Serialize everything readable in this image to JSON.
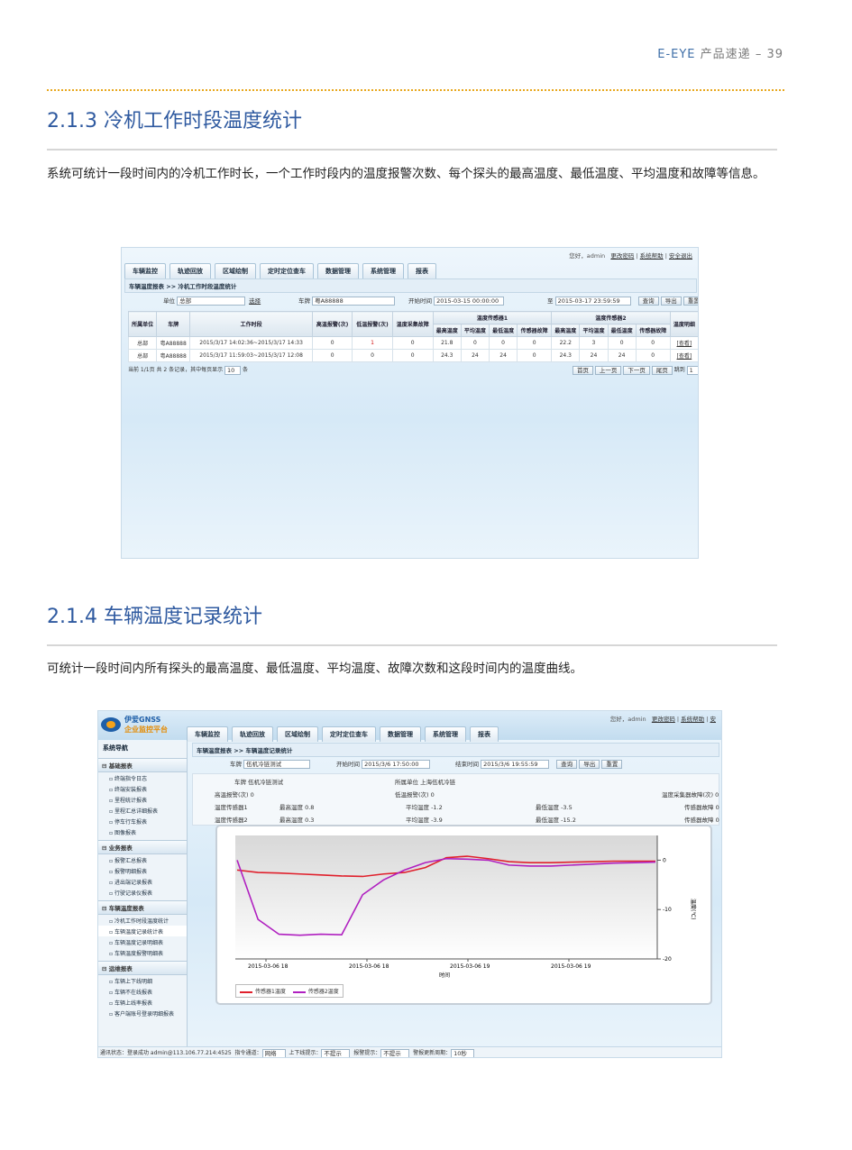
{
  "header": {
    "brand": "E-EYE",
    "section": "产品速递",
    "page_number": "– 39"
  },
  "section1": {
    "title": "2.1.3 冷机工作时段温度统计",
    "desc": "系统可统计一段时间内的冷机工作时长，一个工作时段内的温度报警次数、每个探头的最高温度、最低温度、平均温度和故障等信息。",
    "app": {
      "toplinks": {
        "greeting": "您好，admin",
        "change_pwd": "更改密码",
        "help": "系统帮助",
        "logout": "安全退出"
      },
      "tabs": [
        "车辆监控",
        "轨迹回放",
        "区域绘制",
        "定时定位查车",
        "数据管理",
        "系统管理",
        "报表"
      ],
      "breadcrumb": "车辆温度报表 >> 冷机工作时段温度统计",
      "filters": {
        "unit_label": "单位",
        "unit_value": "总部",
        "select_label": "选择",
        "plate_label": "车牌",
        "plate_value": "粤A88888",
        "start_label": "开始时间",
        "start_value": "2015-03-15 00:00:00",
        "end_label": "至",
        "end_value": "2015-03-17 23:59:59",
        "query": "查询",
        "export": "导出",
        "reset": "重置"
      },
      "table": {
        "headers": [
          "所属单位",
          "车牌",
          "工作时段",
          "高温报警(次)",
          "低温报警(次)",
          "温度采集故障",
          "温度传感器1",
          "温度传感器2",
          "温度明细"
        ],
        "sub_headers": [
          "最高温度",
          "平均温度",
          "最低温度",
          "传感器故障",
          "最高温度",
          "平均温度",
          "最低温度",
          "传感器故障"
        ],
        "rows": [
          [
            "总部",
            "粤A88888",
            "2015/3/17 14:02:36~2015/3/17 14:33",
            "0",
            "1",
            "0",
            "21.8",
            "0",
            "0",
            "0",
            "22.2",
            "3",
            "0",
            "0",
            "[查看]"
          ],
          [
            "总部",
            "粤A88888",
            "2015/3/17 11:59:03~2015/3/17 12:08",
            "0",
            "0",
            "0",
            "24.3",
            "24",
            "24",
            "0",
            "24.3",
            "24",
            "24",
            "0",
            "[查看]"
          ]
        ]
      },
      "pager": {
        "info": "当前 1/1页  共 2 条记录，其中每页显示",
        "page_size": "10",
        "unit": "条",
        "first": "首页",
        "prev": "上一页",
        "next": "下一页",
        "last": "尾页",
        "jump": "跳到",
        "jump_value": "1"
      }
    }
  },
  "section2": {
    "title": "2.1.4 车辆温度记录统计",
    "desc": "可统计一段时间内所有探头的最高温度、最低温度、平均温度、故障次数和这段时间内的温度曲线。",
    "app": {
      "logo_line1": "伊爱GNSS",
      "logo_line2": "企业监控平台",
      "toplinks": {
        "greeting": "您好，admin",
        "change_pwd": "更改密码",
        "help": "系统帮助",
        "more": "安"
      },
      "tabs": [
        "车辆监控",
        "轨迹回放",
        "区域绘制",
        "定时定位查车",
        "数据管理",
        "系统管理",
        "报表"
      ],
      "sidebar": {
        "title": "系统导航",
        "groups": [
          {
            "name": "基础报表",
            "items": [
              "终端指令日志",
              "终端安装报表",
              "里程统计报表",
              "里程汇总详细报表",
              "停车行车报表",
              "图像报表"
            ]
          },
          {
            "name": "业务报表",
            "items": [
              "报警汇总报表",
              "报警明细报表",
              "进出端记录报表",
              "行驶记录仪报表"
            ]
          },
          {
            "name": "车辆温度报表",
            "items": [
              "冷机工作时段温度统计",
              "车辆温度记录统计表",
              "车辆温度记录明细表",
              "车辆温度报警明细表"
            ]
          },
          {
            "name": "运维报表",
            "items": [
              "车辆上下线明细",
              "车辆不在线报表",
              "车辆上线率报表",
              "客户端账号登录明细报表"
            ]
          }
        ]
      },
      "breadcrumb": "车辆温度报表 >> 车辆温度记录统计",
      "filters": {
        "plate_label": "车牌",
        "plate_value": "伍机冷链测试",
        "start_label": "开始时间",
        "start_value": "2015/3/6 17:50:00",
        "end_label": "结束时间",
        "end_value": "2015/3/6 19:55:59",
        "query": "查询",
        "export": "导出",
        "reset": "重置"
      },
      "summary": {
        "plate": "车牌 伍机冷链测试",
        "org": "所属单位 上海伍机冷链",
        "high_alarm": "高温报警(次) 0",
        "low_alarm": "低温报警(次) 0",
        "fault": "温度采集器故障(次) 0",
        "s1": "温度传感器1",
        "s1_max": "最高温度 0.8",
        "s1_avg": "平均温度 -1.2",
        "s1_min": "最低温度 -3.5",
        "s1_fault": "传感器故障 0",
        "s2": "温度传感器2",
        "s2_max": "最高温度 0.3",
        "s2_avg": "平均温度 -3.9",
        "s2_min": "最低温度 -15.2",
        "s2_fault": "传感器故障 0"
      },
      "status": {
        "login": "通讯状态：登录成功 admin@113.106.77.214:4525",
        "cmd_label": "指令通道：",
        "cmd_value": "网络",
        "updown_label": "上下线提示：",
        "updown_value": "不提示",
        "alarm_label": "报警提示：",
        "alarm_value": "不提示",
        "refresh_label": "警报更新周期：",
        "refresh_value": "10秒"
      }
    }
  },
  "chart_data": {
    "type": "line",
    "title": "",
    "xlabel": "时间",
    "ylabel": "温度(℃)",
    "x_ticks": [
      "2015-03-06 18",
      "2015-03-06 18",
      "2015-03-06 19",
      "2015-03-06 19"
    ],
    "y_ticks": [
      "0",
      "-10",
      "-20"
    ],
    "ylim": [
      -20,
      5
    ],
    "x": [
      0,
      1,
      2,
      3,
      4,
      5,
      6,
      7,
      8,
      9,
      10,
      11,
      12,
      13,
      14,
      15,
      16,
      17,
      18,
      19,
      20
    ],
    "series": [
      {
        "name": "传感器1温度",
        "color": "#e0202c",
        "values": [
          -2,
          -2.5,
          -2.6,
          -2.8,
          -3,
          -3.2,
          -3.3,
          -2.8,
          -2.5,
          -1.5,
          0.5,
          0.8,
          0.3,
          -0.3,
          -0.5,
          -0.5,
          -0.4,
          -0.3,
          -0.2,
          -0.2,
          -0.2
        ]
      },
      {
        "name": "传感器2温度",
        "color": "#b020c0",
        "values": [
          0,
          -12,
          -15,
          -15.2,
          -15,
          -15.1,
          -7,
          -4,
          -2,
          -0.5,
          0.3,
          0.2,
          0,
          -1,
          -1.2,
          -1.2,
          -1,
          -0.8,
          -0.6,
          -0.5,
          -0.4
        ]
      }
    ],
    "legend": "bottom-left"
  }
}
